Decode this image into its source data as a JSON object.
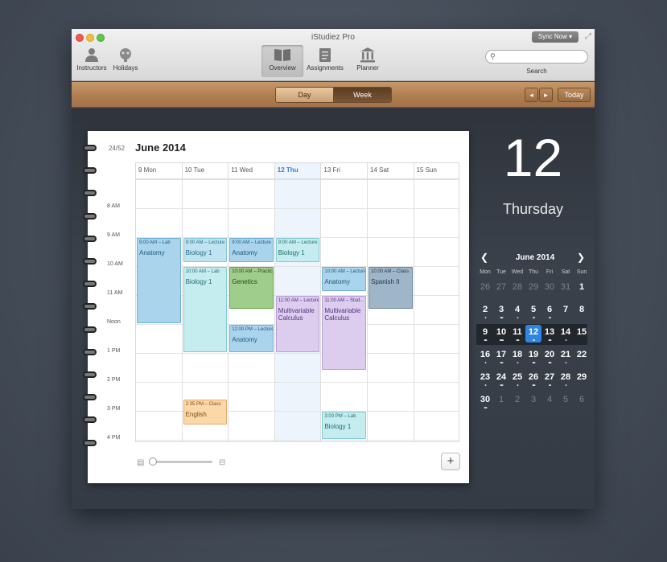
{
  "window": {
    "title": "iStudiez Pro",
    "sync_label": "Sync Now ▾"
  },
  "toolbar": {
    "instructors": "Instructors",
    "holidays": "Holidays",
    "overview": "Overview",
    "assignments": "Assignments",
    "planner": "Planner",
    "search_label": "Search",
    "search_placeholder": ""
  },
  "viewbar": {
    "day": "Day",
    "week": "Week",
    "today": "Today",
    "prev": "◂",
    "next": "▸"
  },
  "planner": {
    "week_number": "24/52",
    "month_title": "June 2014",
    "days": [
      "9 Mon",
      "10 Tue",
      "11 Wed",
      "12 Thu",
      "13 Fri",
      "14 Sat",
      "15 Sun"
    ],
    "today_index": 3,
    "time_labels": [
      "8 AM",
      "9 AM",
      "10 AM",
      "11 AM",
      "Noon",
      "1 PM",
      "2 PM",
      "3 PM",
      "4 PM"
    ],
    "events": [
      {
        "day": 0,
        "start": 9.0,
        "end": 12.0,
        "time": "9:00 AM – Lab",
        "name": "Anatomy",
        "color": "blue"
      },
      {
        "day": 1,
        "start": 9.0,
        "end": 9.9,
        "time": "9:00 AM – Lecture",
        "name": "Biology 1",
        "color": "lightblue"
      },
      {
        "day": 1,
        "start": 10.0,
        "end": 13.0,
        "time": "10:00 AM – Lab",
        "name": "Biology 1",
        "color": "teal"
      },
      {
        "day": 1,
        "start": 14.58,
        "end": 15.5,
        "time": "2:35 PM – Class",
        "name": "English",
        "color": "orange"
      },
      {
        "day": 2,
        "start": 9.0,
        "end": 9.9,
        "time": "9:00 AM – Lecture",
        "name": "Anatomy",
        "color": "blue"
      },
      {
        "day": 2,
        "start": 10.0,
        "end": 11.5,
        "time": "10:00 AM – Practical",
        "name": "Genetics",
        "color": "green"
      },
      {
        "day": 2,
        "start": 12.0,
        "end": 13.0,
        "time": "12:00 PM – Lecture",
        "name": "Anatomy",
        "color": "blue"
      },
      {
        "day": 3,
        "start": 9.0,
        "end": 9.9,
        "time": "9:00 AM – Lecture",
        "name": "Biology 1",
        "color": "teal"
      },
      {
        "day": 3,
        "start": 11.0,
        "end": 13.0,
        "time": "11:00 AM – Lecture",
        "name": "Multivariable Calculus",
        "color": "purple"
      },
      {
        "day": 4,
        "start": 10.0,
        "end": 10.9,
        "time": "10:00 AM – Lecture",
        "name": "Anatomy",
        "color": "blue"
      },
      {
        "day": 4,
        "start": 11.0,
        "end": 13.6,
        "time": "11:00 AM – Stud...",
        "name": "Multivariable Calculus",
        "color": "purple"
      },
      {
        "day": 4,
        "start": 15.0,
        "end": 16.0,
        "time": "3:00 PM – Lab",
        "name": "Biology 1",
        "color": "teal"
      },
      {
        "day": 5,
        "start": 10.0,
        "end": 11.5,
        "time": "10:00 AM – Class",
        "name": "Spanish II",
        "color": "steel"
      }
    ],
    "add_label": "+"
  },
  "sidebar": {
    "big_date": "12",
    "big_weekday": "Thursday",
    "mini_month": "June 2014",
    "weekday_headers": [
      "Mon",
      "Tue",
      "Wed",
      "Thu",
      "Fri",
      "Sat",
      "Sun"
    ],
    "weeks": [
      [
        {
          "d": "26",
          "dim": true
        },
        {
          "d": "27",
          "dim": true
        },
        {
          "d": "28",
          "dim": true
        },
        {
          "d": "29",
          "dim": true
        },
        {
          "d": "30",
          "dim": true
        },
        {
          "d": "31",
          "dim": true
        },
        {
          "d": "1"
        }
      ],
      [
        {
          "d": "2",
          "dots": "•"
        },
        {
          "d": "3",
          "dots": "•••"
        },
        {
          "d": "4",
          "dots": "•"
        },
        {
          "d": "5",
          "dots": "••"
        },
        {
          "d": "6",
          "dots": "••"
        },
        {
          "d": "7"
        },
        {
          "d": "8"
        }
      ],
      [
        {
          "d": "9",
          "dots": "•••"
        },
        {
          "d": "10",
          "dots": "••••"
        },
        {
          "d": "11",
          "dots": "•••"
        },
        {
          "d": "12",
          "dots": "••",
          "sel": true
        },
        {
          "d": "13",
          "dots": "•••"
        },
        {
          "d": "14",
          "dots": "•"
        },
        {
          "d": "15"
        }
      ],
      [
        {
          "d": "16",
          "dots": "•"
        },
        {
          "d": "17",
          "dots": "•••"
        },
        {
          "d": "18",
          "dots": "•"
        },
        {
          "d": "19",
          "dots": "•••"
        },
        {
          "d": "20",
          "dots": "•••"
        },
        {
          "d": "21",
          "dots": "•"
        },
        {
          "d": "22"
        }
      ],
      [
        {
          "d": "23",
          "dots": "•"
        },
        {
          "d": "24",
          "dots": "•••"
        },
        {
          "d": "25",
          "dots": "•"
        },
        {
          "d": "26",
          "dots": "•••"
        },
        {
          "d": "27",
          "dots": "••"
        },
        {
          "d": "28",
          "dots": "•"
        },
        {
          "d": "29"
        }
      ],
      [
        {
          "d": "30",
          "dots": "•••"
        },
        {
          "d": "1",
          "dim": true
        },
        {
          "d": "2",
          "dim": true
        },
        {
          "d": "3",
          "dim": true
        },
        {
          "d": "4",
          "dim": true
        },
        {
          "d": "5",
          "dim": true
        },
        {
          "d": "6",
          "dim": true
        }
      ]
    ]
  }
}
